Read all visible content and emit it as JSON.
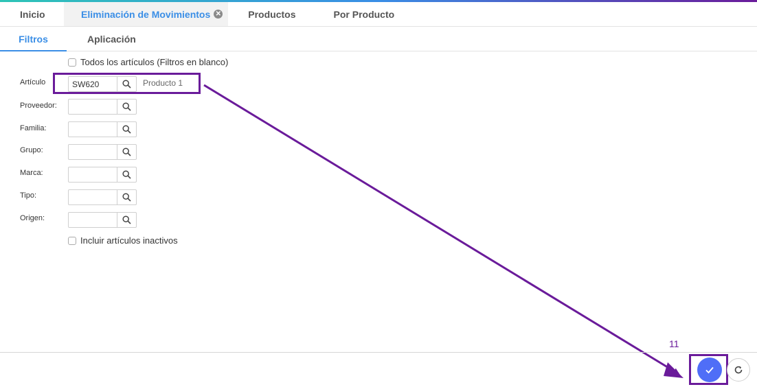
{
  "main_tabs": [
    {
      "label": "Inicio"
    },
    {
      "label": "Eliminación de Movimientos",
      "active": true
    },
    {
      "label": "Productos"
    },
    {
      "label": "Por Producto"
    }
  ],
  "sub_tabs": [
    {
      "label": "Filtros",
      "active": true
    },
    {
      "label": "Aplicación"
    }
  ],
  "filters": {
    "all_items_checkbox": "Todos los artículos (Filtros en blanco)",
    "include_inactive_checkbox": "Incluir artículos inactivos",
    "fields": [
      {
        "label": "Artículo",
        "value": "SW620",
        "description": "Producto 1"
      },
      {
        "label": "Proveedor:",
        "value": ""
      },
      {
        "label": "Familia:",
        "value": ""
      },
      {
        "label": "Grupo:",
        "value": ""
      },
      {
        "label": "Marca:",
        "value": ""
      },
      {
        "label": "Tipo:",
        "value": ""
      },
      {
        "label": "Origen:",
        "value": ""
      }
    ]
  },
  "annotation": {
    "step_number": "11",
    "color": "#6a1b9a"
  },
  "colors": {
    "accent": "#3a8ee6",
    "confirm_button": "#4f6ef7"
  },
  "icons": {
    "search": "search-icon",
    "close": "close-icon",
    "confirm": "checkmark-icon",
    "refresh": "refresh-icon"
  }
}
